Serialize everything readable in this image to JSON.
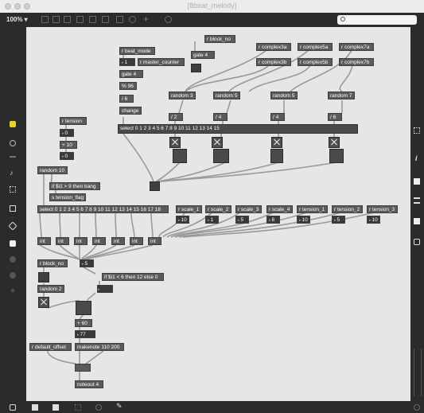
{
  "window": {
    "title": "[8beat_melody]"
  },
  "toolbar": {
    "zoom": "100% ▾",
    "search_placeholder": ""
  },
  "patch": {
    "rbeat_mode": "r beat_mode",
    "rblock_no_top": "r block_no",
    "gate4_top": "gate 4",
    "num1": "1",
    "rmaster_counter": "r master_counter",
    "gate4_b": "gate 4",
    "mod96": "% 96",
    "div6": "/ 6",
    "change": "change",
    "rcomplex3a": "r complex3a",
    "rcomplex5a": "r complex5a",
    "rcomplex7a": "r complex7a",
    "rcomplex3b": "r complex3b",
    "rcomplex5b": "r complex5b",
    "rcomplex7b": "r complex7b",
    "random3": "random 3",
    "random5a": "random 5",
    "random5b": "random 5",
    "random7": "random 7",
    "div2": "/ 2",
    "div4a": "/ 4",
    "div4b": "/ 4",
    "div6b": "/ 6",
    "select_top": "select 0 1 2 3 4 5 6 7 8 9 10 11 12 13 14 15",
    "rtension": "r tension",
    "num0a": "0",
    "plus10": "+ 10",
    "num0b": "0",
    "random10": "random 10",
    "if_bang": "if $i1 > 9 then bang",
    "stension_flag": "s tension_flag",
    "select_mid": "select 0 1 2 3 4 5 6 7 8 9 10 11 12 13 14 15 16 17 18",
    "rscale_1": "r scale_1",
    "rscale_2": "r scale_2",
    "rscale_3": "r scale_3",
    "rscale_4": "r scale_4",
    "rtension_1": "r tension_1",
    "rtension_2": "r tension_2",
    "rtension_3": "r tension_3",
    "vals": [
      "10",
      "1",
      "5",
      "8",
      "10",
      "5",
      "10"
    ],
    "int_label": "int",
    "rblock_no_low": "r block_no",
    "num5": "5",
    "if_else": "if $i1 < 6 then 12 else 0",
    "random2": "random 2",
    "plus60": "+ 60",
    "num77": "77",
    "rdefault_offset": "r default_offset",
    "makenote": "makenote 110 200",
    "noteout": "noteout 4"
  }
}
